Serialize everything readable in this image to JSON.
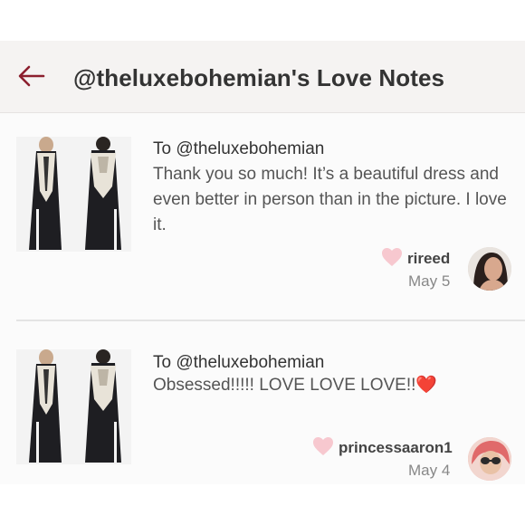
{
  "header": {
    "back_icon": "arrow-left-icon",
    "title": "@theluxebohemian's Love Notes",
    "accent_color": "#8c1f2e"
  },
  "notes": [
    {
      "to": "To @theluxebohemian",
      "message": "Thank you so much! It’s a beautiful dress and even better in person than in the picture. I love it.",
      "username": "rireed",
      "date": "May 5",
      "heart_icon": "heart-icon",
      "heart_color": "#f7c8cf"
    },
    {
      "to": "To @theluxebohemian",
      "message": "Obsessed!!!!! LOVE LOVE LOVE!!❤️",
      "username": "princessaaron1",
      "date": "May 4",
      "heart_icon": "heart-icon",
      "heart_color": "#f7c8cf"
    }
  ]
}
